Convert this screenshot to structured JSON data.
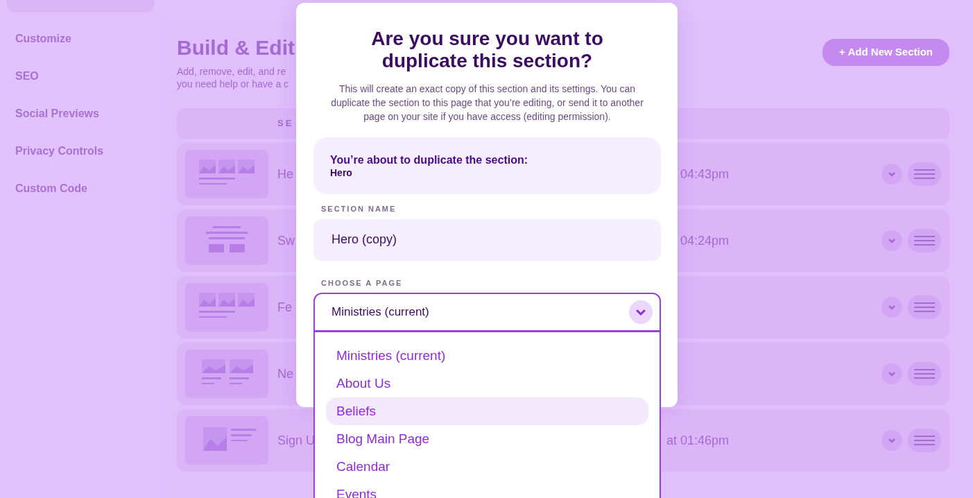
{
  "sidebar": {
    "items": [
      {
        "label": "Customize"
      },
      {
        "label": "SEO"
      },
      {
        "label": "Social Previews"
      },
      {
        "label": "Privacy Controls"
      },
      {
        "label": "Custom Code"
      }
    ]
  },
  "main": {
    "title": "Build & Edit",
    "description_lines": [
      "Add, remove, edit, and re",
      "you need help or have a c"
    ],
    "add_button": "+ Add New Section",
    "column_header": "SE",
    "rows": [
      {
        "kind": "gallery3",
        "name": "He",
        "updated": "04:43pm"
      },
      {
        "kind": "text",
        "name": "Sw",
        "updated": "04:24pm"
      },
      {
        "kind": "gallery3",
        "name": "Fe"
      },
      {
        "kind": "gallery2",
        "name": "Ne"
      },
      {
        "kind": "media",
        "name": "Sign U",
        "updated": "at 01:46pm"
      }
    ]
  },
  "modal": {
    "title": "Are you sure you want to duplicate this section?",
    "description": "This will create an exact copy of this section and its settings. You can duplicate the section to this page that you’re editing, or send it to another page on your site if you have access (editing permission).",
    "notice": {
      "heading": "You’re about to duplicate the section:",
      "section": "Hero"
    },
    "section_name": {
      "label": "SECTION NAME",
      "value": "Hero (copy)"
    },
    "page_select": {
      "label": "CHOOSE A PAGE",
      "value": "Ministries (current)",
      "expanded": true,
      "options": [
        {
          "label": "Ministries (current)",
          "highlighted": false
        },
        {
          "label": "About Us",
          "highlighted": false
        },
        {
          "label": "Beliefs",
          "highlighted": true
        },
        {
          "label": "Blog Main Page",
          "highlighted": false
        },
        {
          "label": "Calendar",
          "highlighted": false
        },
        {
          "label": "Events",
          "highlighted": false
        }
      ]
    }
  }
}
